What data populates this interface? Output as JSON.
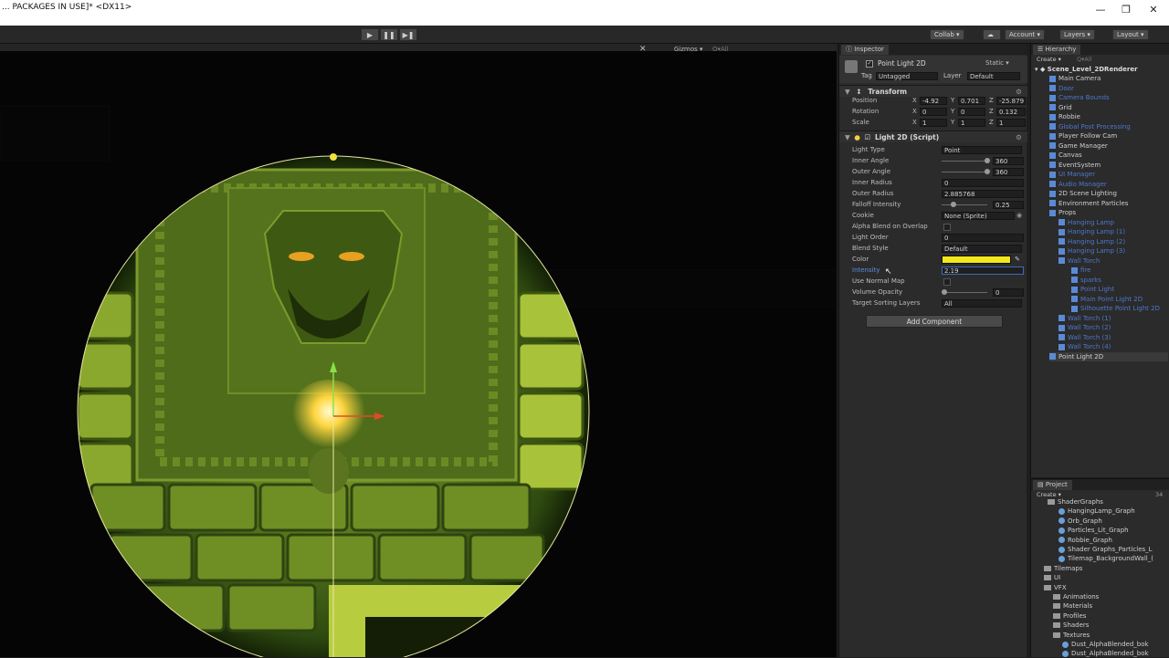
{
  "window": {
    "title": "... PACKAGES IN USE]* <DX11>",
    "minimize": "—",
    "maximize": "❐",
    "close": "✕"
  },
  "toolbar": {
    "play": "▶",
    "pause": "❚❚",
    "step": "▶❚",
    "collab": "Collab ▾",
    "account": "Account ▾",
    "layers": "Layers ▾",
    "layout": "Layout ▾"
  },
  "scene_bar": {
    "gizmos": "Gizmos ▾",
    "all": "Q▾All"
  },
  "inspector": {
    "tab": "Inspector",
    "object_name": "Point Light 2D",
    "static_label": "Static ▾",
    "tag_label": "Tag",
    "tag_value": "Untagged",
    "layer_label": "Layer",
    "layer_value": "Default",
    "transform": {
      "title": "Transform",
      "position_label": "Position",
      "rotation_label": "Rotation",
      "scale_label": "Scale",
      "position": {
        "x": "-4.92",
        "y": "0.701",
        "z": "-25.879"
      },
      "rotation": {
        "x": "0",
        "y": "0",
        "z": "0.132"
      },
      "scale": {
        "x": "1",
        "y": "1",
        "z": "1"
      }
    },
    "light2d": {
      "title": "Light 2D (Script)",
      "light_type_label": "Light Type",
      "light_type_value": "Point",
      "inner_angle_label": "Inner Angle",
      "inner_angle_value": "360",
      "outer_angle_label": "Outer Angle",
      "outer_angle_value": "360",
      "inner_radius_label": "Inner Radius",
      "inner_radius_value": "0",
      "outer_radius_label": "Outer Radius",
      "outer_radius_value": "2.885768",
      "falloff_label": "Falloff Intensity",
      "falloff_value": "0.25",
      "cookie_label": "Cookie",
      "cookie_value": "None (Sprite)",
      "alpha_blend_label": "Alpha Blend on Overlap",
      "light_order_label": "Light Order",
      "light_order_value": "0",
      "blend_style_label": "Blend Style",
      "blend_style_value": "Default",
      "color_label": "Color",
      "color_hex": "#f2e81c",
      "intensity_label": "Intensity",
      "intensity_value": "2.19",
      "normal_map_label": "Use Normal Map",
      "volume_opacity_label": "Volume Opacity",
      "volume_opacity_value": "0",
      "target_layers_label": "Target Sorting Layers",
      "target_layers_value": "All"
    },
    "add_component": "Add Component"
  },
  "hierarchy": {
    "tab": "Hierarchy",
    "create": "Create ▾",
    "search": "Q▾All",
    "scene": "Scene_Level_2DRenderer",
    "items": [
      {
        "label": "Main Camera",
        "blue": false
      },
      {
        "label": "Door",
        "blue": true
      },
      {
        "label": "Camera Bounds",
        "blue": true
      },
      {
        "label": "Grid",
        "blue": false
      },
      {
        "label": "Robbie",
        "blue": false
      },
      {
        "label": "Global Post Processing",
        "blue": true
      },
      {
        "label": "Player Follow Cam",
        "blue": false
      },
      {
        "label": "Game Manager",
        "blue": false
      },
      {
        "label": "Canvas",
        "blue": false
      },
      {
        "label": "EventSystem",
        "blue": false
      },
      {
        "label": "UI Manager",
        "blue": true
      },
      {
        "label": "Audio Manager",
        "blue": true
      },
      {
        "label": "2D Scene Lighting",
        "blue": false
      },
      {
        "label": "Environment Particles",
        "blue": false
      },
      {
        "label": "Props",
        "blue": false
      },
      {
        "label": "Hanging Lamp",
        "blue": true
      },
      {
        "label": "Hanging Lamp (1)",
        "blue": true
      },
      {
        "label": "Hanging Lamp (2)",
        "blue": true
      },
      {
        "label": "Hanging Lamp (3)",
        "blue": true
      },
      {
        "label": "Wall Torch",
        "blue": true
      },
      {
        "label": "fire",
        "blue": true
      },
      {
        "label": "sparks",
        "blue": true
      },
      {
        "label": "Point Light",
        "blue": true
      },
      {
        "label": "Main Point Light 2D",
        "blue": true
      },
      {
        "label": "Silhouette Point Light 2D",
        "blue": true
      },
      {
        "label": "Wall Torch (1)",
        "blue": true
      },
      {
        "label": "Wall Torch (2)",
        "blue": true
      },
      {
        "label": "Wall Torch (3)",
        "blue": true
      },
      {
        "label": "Wall Torch (4)",
        "blue": true
      },
      {
        "label": "Point Light 2D",
        "blue": false
      }
    ]
  },
  "project": {
    "tab": "Project",
    "create": "Create ▾",
    "count": "34",
    "items": [
      {
        "label": "ShaderGraphs",
        "kind": "folder"
      },
      {
        "label": "HangingLamp_Graph",
        "kind": "sg"
      },
      {
        "label": "Orb_Graph",
        "kind": "sg"
      },
      {
        "label": "Particles_Lit_Graph",
        "kind": "sg"
      },
      {
        "label": "Robbie_Graph",
        "kind": "sg"
      },
      {
        "label": "Shader Graphs_Particles_L",
        "kind": "sg"
      },
      {
        "label": "Tilemap_BackgroundWall_(",
        "kind": "sg"
      },
      {
        "label": "Tilemaps",
        "kind": "folder"
      },
      {
        "label": "UI",
        "kind": "folder"
      },
      {
        "label": "VFX",
        "kind": "folder"
      },
      {
        "label": "Animations",
        "kind": "folder"
      },
      {
        "label": "Materials",
        "kind": "folder"
      },
      {
        "label": "Profiles",
        "kind": "folder"
      },
      {
        "label": "Shaders",
        "kind": "folder"
      },
      {
        "label": "Textures",
        "kind": "folder"
      },
      {
        "label": "Dust_AlphaBlended_bok",
        "kind": "sg"
      },
      {
        "label": "Dust_AlphaBlended_bok",
        "kind": "sg"
      }
    ]
  }
}
